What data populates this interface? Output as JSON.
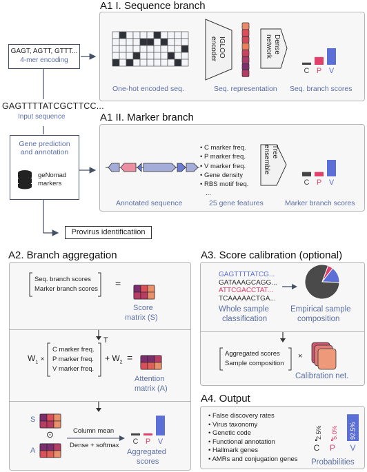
{
  "left_flow": {
    "kmer_box": {
      "line1": "GAGT, AGTT, GTTT...",
      "line2": "4-mer encoding"
    },
    "input_sequence": {
      "text": "GAGTTTTATCGCTTCC...",
      "label": "Input sequence"
    },
    "gene_box": {
      "line1": "Gene prediction",
      "line2": "and annotation",
      "db_label_1": "geNomad",
      "db_label_2": "markers"
    },
    "provirus_box": "Provirus identificatiion"
  },
  "a1_seq": {
    "title": "A1 I. Sequence branch",
    "onehot_caption": "One-hot encoded seq.",
    "encoder_label_1": "IGLOO",
    "encoder_label_2": "encoder",
    "representation_caption": "Seq. representation",
    "dense_label_1": "Dense",
    "dense_label_2": "network",
    "scores_caption": "Seq. branch scores",
    "score_labels": [
      "C",
      "P",
      "V"
    ],
    "scores": [
      0.1,
      0.35,
      0.75
    ],
    "onehot_grid": [
      [
        0,
        1,
        0,
        0,
        0,
        0,
        1,
        0,
        0,
        0,
        0
      ],
      [
        0,
        0,
        0,
        0,
        1,
        1,
        0,
        1,
        0,
        0,
        0
      ],
      [
        0,
        0,
        0,
        0,
        0,
        0,
        0,
        0,
        0,
        0,
        1
      ],
      [
        0,
        0,
        0,
        1,
        0,
        0,
        0,
        0,
        1,
        0,
        0
      ],
      [
        1,
        0,
        1,
        0,
        0,
        0,
        0,
        0,
        0,
        1,
        0
      ]
    ],
    "representation_colors": [
      "#e8896a",
      "#d9505a",
      "#d04a5e",
      "#e8805e",
      "#c8435e",
      "#a93a6a",
      "#7e2e6c",
      "#b33c64"
    ]
  },
  "a1_marker": {
    "title": "A1 II. Marker branch",
    "annotated_caption": "Annotated sequence",
    "features": [
      "C marker freq.",
      "P marker freq.",
      "V marker freq.",
      "Gene density",
      "RBS motif freq.",
      "..."
    ],
    "features_caption": "25 gene features",
    "tree_label_1": "Tree",
    "tree_label_2": "ensemble",
    "scores_caption": "Marker branch scores",
    "score_labels": [
      "C",
      "P",
      "V"
    ],
    "scores": [
      0.2,
      0.2,
      0.75
    ]
  },
  "a2": {
    "title": "A2. Branch aggregation",
    "score_rows": [
      "Seq. branch scores",
      "Marker branch scores"
    ],
    "score_matrix_label_1": "Score",
    "score_matrix_label_2": "matrix (S)",
    "w1": "W",
    "w1_sub": "1",
    "times": "×",
    "freq_rows": [
      "C marker freq.",
      "P marker freq.",
      "V marker freq."
    ],
    "transpose": "T",
    "plus_w2": "+ W",
    "w2_sub": "2",
    "equals": "=",
    "attention_label_1": "Attention",
    "attention_label_2": "matrix (A)",
    "s_label": "S",
    "a_label": "A",
    "hadamard": "⊙",
    "column_mean": "Column mean",
    "dense_softmax": "Dense + softmax",
    "agg_label_1": "Aggregated",
    "agg_label_2": "scores",
    "score_labels": [
      "C",
      "P",
      "V"
    ],
    "agg_scores": [
      0.05,
      0.05,
      0.9
    ],
    "s_matrix_colors": [
      [
        "#7b2d6e",
        "#d9505a",
        "#e8906a"
      ],
      [
        "#b63d66",
        "#b83c62",
        "#e8906a"
      ]
    ],
    "a_matrix_colors": [
      [
        "#7b2d6e",
        "#7b2d6e",
        "#b63d66"
      ],
      [
        "#d9505a",
        "#e06058",
        "#e8906a"
      ]
    ]
  },
  "a3": {
    "title": "A3. Score calibration (optional)",
    "sequences": [
      {
        "text": "GAGTTTTATCG...",
        "color": "#5b6fd6"
      },
      {
        "text": "GATAAAGCAGG...",
        "color": "#333333"
      },
      {
        "text": "ATTCGACCTAT...",
        "color": "#e0406a"
      },
      {
        "text": "TCAAAAACTGA...",
        "color": "#333333"
      }
    ],
    "whole_label_1": "Whole sample",
    "whole_label_2": "classification",
    "empirical_label_1": "Empirical sample",
    "empirical_label_2": "composition",
    "composition": [
      {
        "name": "C",
        "fraction": 0.8,
        "color": "#4a4a4a"
      },
      {
        "name": "P",
        "fraction": 0.05,
        "color": "#e0406a"
      },
      {
        "name": "V",
        "fraction": 0.15,
        "color": "#5b6fd6"
      }
    ],
    "calib_rows": [
      "Aggregated scores",
      "Sample composition"
    ],
    "times": "×",
    "calib_label": "Calibration net."
  },
  "a4": {
    "title": "A4. Output",
    "outputs": [
      "False discovery rates",
      "Virus taxonomy",
      "Genetic code",
      "Functional annotation",
      "Hallmark genes",
      "AMRs and conjugation genes"
    ],
    "probabilities": [
      {
        "label": "C",
        "value": "2.5%",
        "fraction": 0.025,
        "color": "#333333"
      },
      {
        "label": "P",
        "value": "5.0%",
        "fraction": 0.05,
        "color": "#e0406a"
      },
      {
        "label": "V",
        "value": "92.5%",
        "fraction": 0.925,
        "color": "#5b6fd6"
      }
    ],
    "prob_label": "Probabilities"
  },
  "colors": {
    "c": "#444444",
    "p": "#e0406a",
    "v": "#5b6fd6",
    "caption": "#5b6ea6"
  }
}
